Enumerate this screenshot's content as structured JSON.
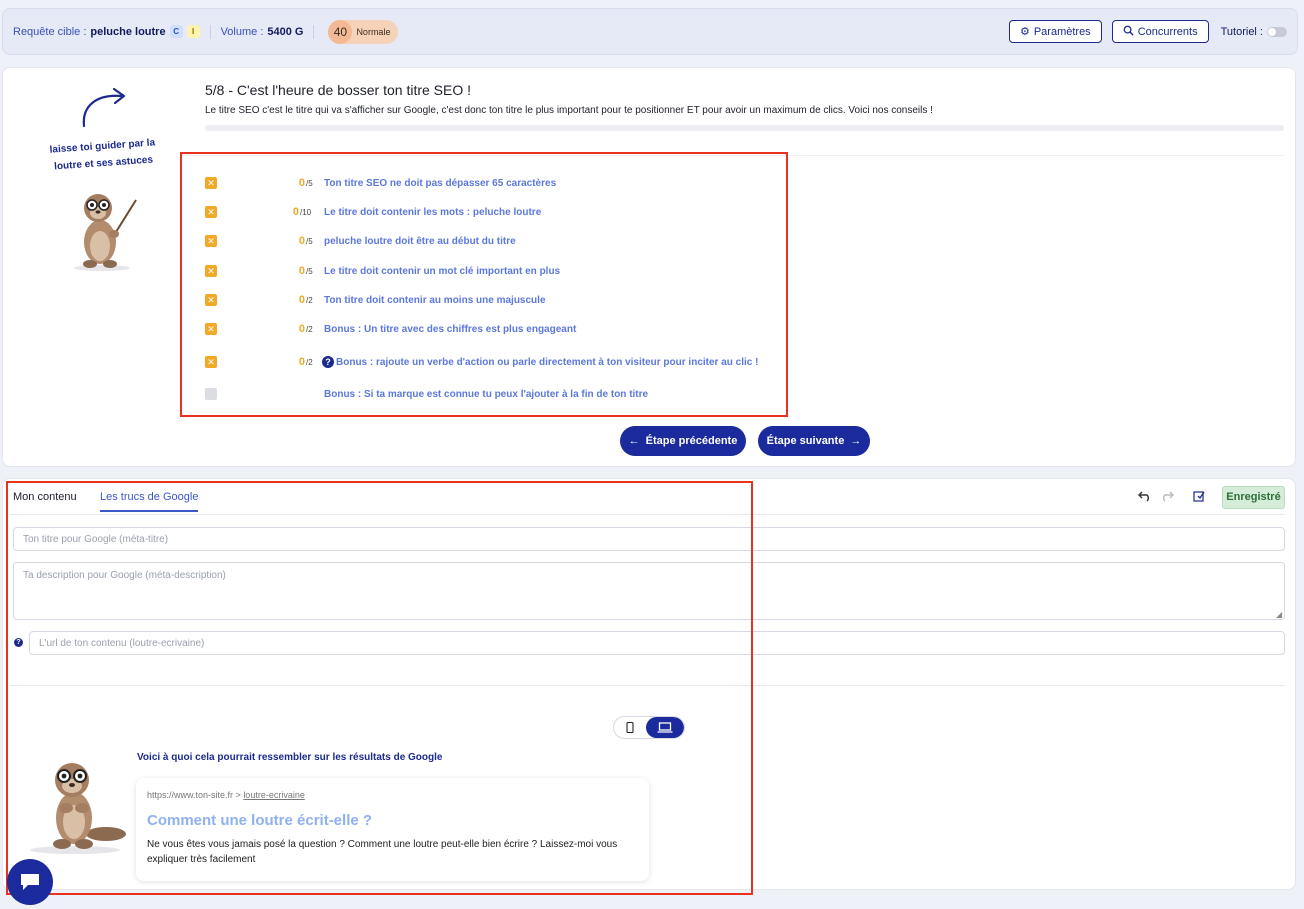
{
  "topbar": {
    "query_label": "Requête cible :",
    "query_value": "peluche loutre",
    "tag_c": "C",
    "tag_i": "I",
    "volume_label": "Volume :",
    "volume_value": "5400",
    "volume_icon": "google-g-icon",
    "score": "40",
    "score_label": "Normale",
    "settings_label": "Paramètres",
    "competitors_label": "Concurrents",
    "tutorial_label": "Tutoriel :"
  },
  "guide": {
    "text": "laisse toi guider par la loutre et ses astuces"
  },
  "step": {
    "title": "5/8 - C'est l'heure de bosser ton titre SEO !",
    "description": "Le titre SEO c'est le titre qui va s'afficher sur Google, c'est donc ton titre le plus important pour te positionner ET pour avoir un maximum de clics. Voici nos conseils !"
  },
  "criteria": [
    {
      "score": "0",
      "max": "/5",
      "text": "Ton titre SEO ne doit pas dépasser 65 caractères"
    },
    {
      "score": "0",
      "max": "/10",
      "text": "Le titre doit contenir les mots : peluche loutre"
    },
    {
      "score": "0",
      "max": "/5",
      "text": "peluche loutre doit être au début du titre"
    },
    {
      "score": "0",
      "max": "/5",
      "text": "Le titre doit contenir un mot clé important en plus"
    },
    {
      "score": "0",
      "max": "/2",
      "text": "Ton titre doit contenir au moins une majuscule"
    },
    {
      "score": "0",
      "max": "/2",
      "text": "Bonus : Un titre avec des chiffres est plus engageant"
    },
    {
      "score": "0",
      "max": "/2",
      "text": "Bonus : rajoute un verbe d'action ou parle directement à ton visiteur pour inciter au clic !"
    },
    {
      "score": "",
      "max": "",
      "text": "Bonus : Si ta marque est connue tu peux l'ajouter à la fin de ton titre"
    }
  ],
  "nav": {
    "prev_label": "Étape précédente",
    "next_label": "Étape suivante"
  },
  "tabs": {
    "content": "Mon contenu",
    "google": "Les trucs de Google"
  },
  "editor": {
    "saved_label": "Enregistré",
    "meta_title_placeholder": "Ton titre pour Google (méta-titre)",
    "meta_desc_placeholder": "Ta description pour Google (méta-description)",
    "url_placeholder": "L'url de ton contenu (loutre-ecrivaine)"
  },
  "preview": {
    "label": "Voici à quoi cela pourrait ressembler sur les résultats de Google",
    "url_base": "https://www.ton-site.fr >",
    "url_slug": "loutre-ecrivaine",
    "title": "Comment une loutre écrit-elle ?",
    "description": "Ne vous êtes vous jamais posé la question ? Comment une loutre peut-elle bien écrire ? Laissez-moi vous expliquer très facilement"
  },
  "colors": {
    "primary": "#1b2a9c",
    "accent_link": "#5b78db",
    "warning": "#f0a928",
    "highlight_border": "#e8321f"
  }
}
